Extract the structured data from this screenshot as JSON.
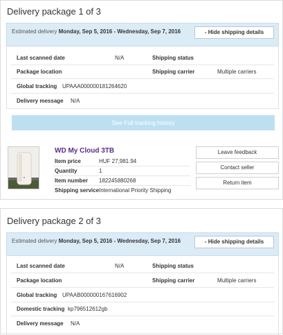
{
  "packages": [
    {
      "title": "Delivery package 1 of 3",
      "estimate_label": "Estimated delivery",
      "estimate_dates": "Monday, Sep 5, 2016 - Wednesday, Sep 7, 2016",
      "hide_button": "- Hide shipping details",
      "last_scanned_label": "Last scanned date",
      "last_scanned_value": "N/A",
      "shipping_status_label": "Shipping status",
      "location_label": "Package location",
      "carrier_label": "Shipping carrier",
      "carrier_value": "Multiple carriers",
      "global_tracking_label": "Global tracking",
      "global_tracking_value": "UPAAA000000181264620",
      "delivery_message_label": "Delivery message",
      "delivery_message_value": "N/A",
      "full_tracking_button": "See Full tracking history"
    },
    {
      "title": "Delivery package 2 of 3",
      "estimate_label": "Estimated delivery",
      "estimate_dates": "Monday, Sep 5, 2016 - Wednesday, Sep 7, 2016",
      "hide_button": "- Hide shipping details",
      "last_scanned_label": "Last scanned date",
      "last_scanned_value": "N/A",
      "shipping_status_label": "Shipping status",
      "location_label": "Package location",
      "carrier_label": "Shipping carrier",
      "carrier_value": "Multiple carriers",
      "global_tracking_label": "Global tracking",
      "global_tracking_value": "UPAAB000000167616902",
      "domestic_tracking_label": "Domestic tracking",
      "domestic_tracking_value": "kp796512612gb",
      "delivery_message_label": "Delivery message",
      "delivery_message_value": "N/A"
    }
  ],
  "item": {
    "title": "WD My Cloud 3TB",
    "price_label": "Item price",
    "price_value": "HUF 27,981.94",
    "quantity_label": "Quantity",
    "quantity_value": "1",
    "number_label": "Item number",
    "number_value": "182245880268",
    "service_label": "Shipping service",
    "service_value": "International Priority Shipping",
    "actions": [
      "Leave feedback",
      "Contact seller",
      "Return item"
    ]
  },
  "colors": {
    "estimate_bar": "#dbecf6",
    "tracking_button": "#bde0f1",
    "item_title": "#5a2c91"
  }
}
